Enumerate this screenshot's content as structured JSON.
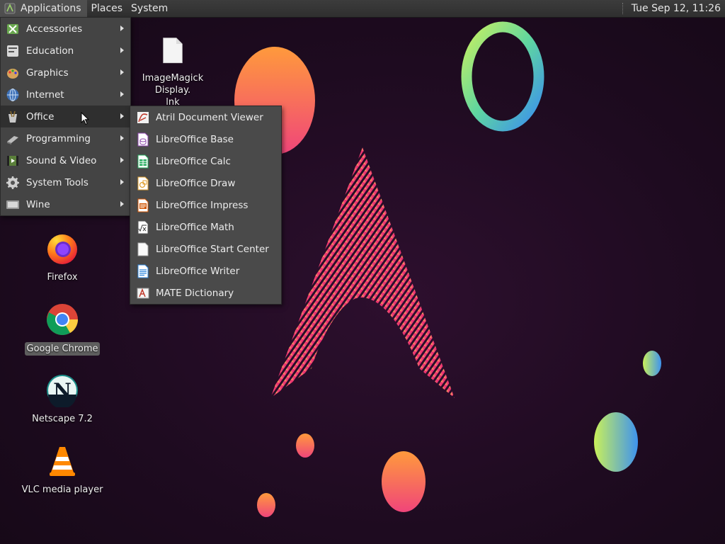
{
  "panel": {
    "menus": [
      "Applications",
      "Places",
      "System"
    ],
    "clock": "Tue Sep 12, 11:26"
  },
  "app_menu": {
    "items": [
      {
        "label": "Accessories",
        "icon": "accessories-icon"
      },
      {
        "label": "Education",
        "icon": "education-icon"
      },
      {
        "label": "Graphics",
        "icon": "graphics-icon"
      },
      {
        "label": "Internet",
        "icon": "internet-icon"
      },
      {
        "label": "Office",
        "icon": "office-icon",
        "active": true
      },
      {
        "label": "Programming",
        "icon": "programming-icon"
      },
      {
        "label": "Sound & Video",
        "icon": "sound-video-icon"
      },
      {
        "label": "System Tools",
        "icon": "system-tools-icon"
      },
      {
        "label": "Wine",
        "icon": "wine-icon"
      }
    ]
  },
  "office_submenu": {
    "items": [
      {
        "label": "Atril Document Viewer",
        "icon": "atril-icon"
      },
      {
        "label": "LibreOffice Base",
        "icon": "libreoffice-base-icon"
      },
      {
        "label": "LibreOffice Calc",
        "icon": "libreoffice-calc-icon"
      },
      {
        "label": "LibreOffice Draw",
        "icon": "libreoffice-draw-icon"
      },
      {
        "label": "LibreOffice Impress",
        "icon": "libreoffice-impress-icon"
      },
      {
        "label": "LibreOffice Math",
        "icon": "libreoffice-math-icon"
      },
      {
        "label": "LibreOffice Start Center",
        "icon": "libreoffice-start-icon"
      },
      {
        "label": "LibreOffice Writer",
        "icon": "libreoffice-writer-icon"
      },
      {
        "label": "MATE Dictionary",
        "icon": "dictionary-icon"
      }
    ]
  },
  "desktop": {
    "icons": [
      {
        "label": "ImageMagick Display.\nlnk",
        "label_line1": "ImageMagick Display.",
        "label_line2": "lnk",
        "icon": "file-icon"
      },
      {
        "label": "Firefox",
        "icon": "firefox-icon"
      },
      {
        "label": "Google Chrome",
        "icon": "chrome-icon",
        "selected": true
      },
      {
        "label": "Netscape 7.2",
        "icon": "netscape-icon"
      },
      {
        "label": "VLC media player",
        "icon": "vlc-icon"
      }
    ]
  },
  "colors": {
    "panel_bg": "#333333",
    "menu_bg": "#444444",
    "desktop_bg": "#1e0b20",
    "accent_pink": "#e8266f",
    "accent_orange": "#ff9a3c"
  }
}
